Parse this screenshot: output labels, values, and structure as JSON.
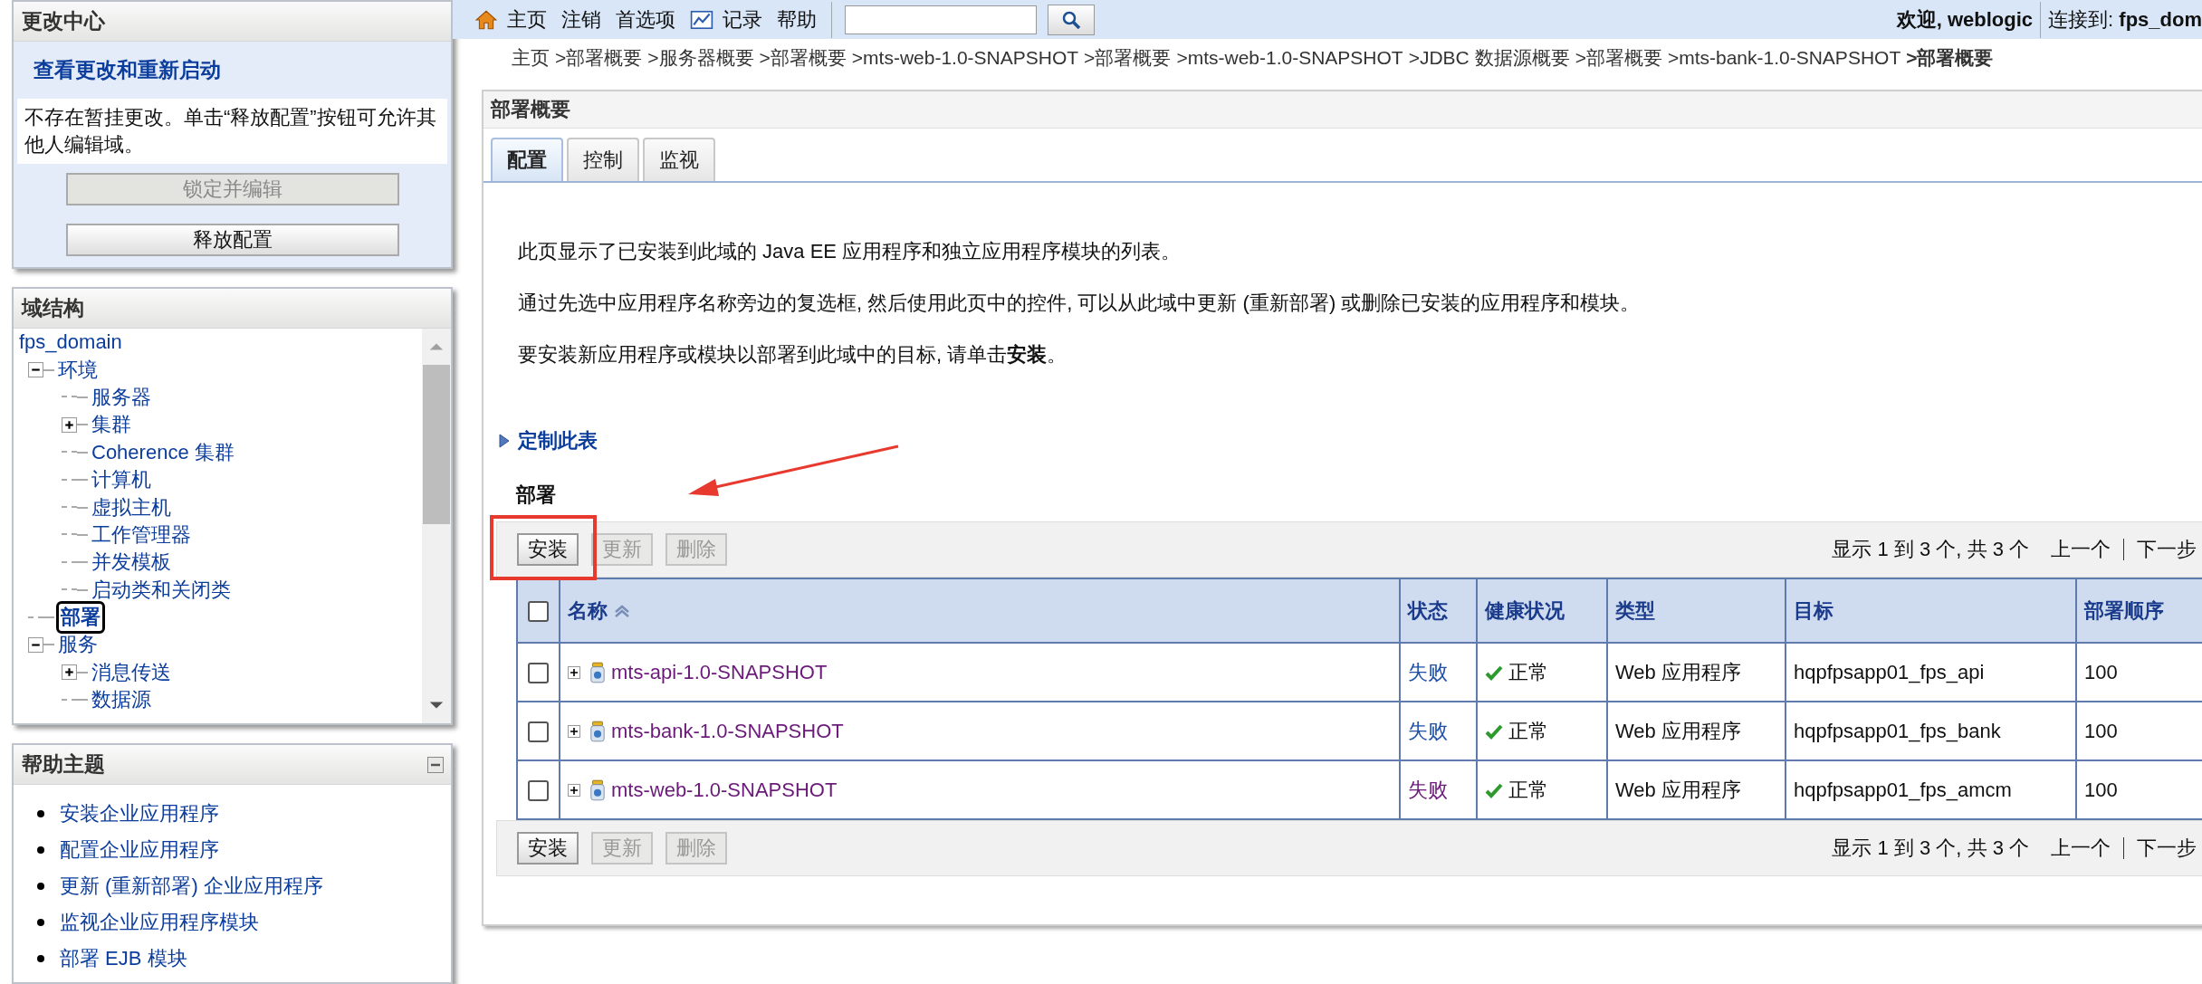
{
  "change_center": {
    "title": "更改中心",
    "link": "查看更改和重新启动",
    "message": "不存在暂挂更改。单击“释放配置”按钮可允许其他人编辑域。",
    "buttons": [
      {
        "label": "锁定并编辑",
        "disabled": true
      },
      {
        "label": "释放配置",
        "disabled": false
      }
    ]
  },
  "domain_structure": {
    "title": "域结构",
    "tree": {
      "label": "fps_domain",
      "selected": false,
      "children": [
        {
          "label": "环境",
          "selected": false,
          "expanded": true,
          "children": [
            {
              "label": "服务器",
              "selected": false
            },
            {
              "label": "集群",
              "selected": false,
              "expanded": false
            },
            {
              "label": "Coherence 集群",
              "selected": false
            },
            {
              "label": "计算机",
              "selected": false
            },
            {
              "label": "虚拟主机",
              "selected": false
            },
            {
              "label": "工作管理器",
              "selected": false
            },
            {
              "label": "并发模板",
              "selected": false
            },
            {
              "label": "启动类和关闭类",
              "selected": false
            }
          ]
        },
        {
          "label": "部署",
          "selected": true
        },
        {
          "label": "服务",
          "selected": false,
          "expanded": true,
          "children": [
            {
              "label": "消息传送",
              "selected": false,
              "expanded": false
            },
            {
              "label": "数据源",
              "selected": false
            }
          ]
        }
      ]
    }
  },
  "help_topics": {
    "title": "帮助主题",
    "items": [
      "安装企业应用程序",
      "配置企业应用程序",
      "更新 (重新部署) 企业应用程序",
      "监视企业应用程序模块",
      "部署 EJB 模块"
    ]
  },
  "top_bar": {
    "links": [
      {
        "label": "主页",
        "kind": "home"
      },
      {
        "label": "注销",
        "kind": "plain"
      },
      {
        "label": "首选项",
        "kind": "plain"
      },
      {
        "label": "记录",
        "kind": "record"
      },
      {
        "label": "帮助",
        "kind": "plain"
      }
    ],
    "welcome": "欢迎, weblogic",
    "connection": "连接到: **fps_dom**"
  },
  "breadcrumbs": [
    "主页",
    ">部署概要",
    ">服务器概要",
    ">部署概要",
    ">mts-web-1.0-SNAPSHOT",
    ">部署概要",
    ">mts-web-1.0-SNAPSHOT",
    ">JDBC 数据源概要",
    ">部署概要",
    ">mts-bank-1.0-SNAPSHOT",
    ">部署概要"
  ],
  "panel": {
    "title": "部署概要",
    "tabs": [
      {
        "label": "配置",
        "selected": true
      },
      {
        "label": "控制",
        "selected": false
      },
      {
        "label": "监视",
        "selected": false
      }
    ],
    "paragraphs": [
      "此页显示了已安装到此域的 Java EE 应用程序和独立应用程序模块的列表。",
      "通过先选中应用程序名称旁边的复选框, 然后使用此页中的控件, 可以从此域中更新 (重新部署) 或删除已安装的应用程序和模块。",
      "要安装新应用程序或模块以部署到此域中的目标, 请单击**安装**。"
    ],
    "customize": "定制此表",
    "table_title": "部署",
    "top_toolbar": {
      "buttons": [
        {
          "label": "安装",
          "disabled": false
        },
        {
          "label": "更新",
          "disabled": true
        },
        {
          "label": "删除",
          "disabled": true
        }
      ],
      "pager": "显示 1 到 3 个, 共 3 个",
      "prev": "上一个",
      "next": "下一步"
    },
    "table": {
      "select_all_checked": false,
      "columns": [
        "名称",
        "状态",
        "健康状况",
        "类型",
        "目标",
        "部署顺序"
      ],
      "rows": [
        {
          "checked": false,
          "name": "mts-api-1.0-SNAPSHOT",
          "status": "失败",
          "status_visited": false,
          "health": "正常",
          "type": "Web 应用程序",
          "target": "hqpfpsapp01_fps_api",
          "order": "100"
        },
        {
          "checked": false,
          "name": "mts-bank-1.0-SNAPSHOT",
          "status": "失败",
          "status_visited": false,
          "health": "正常",
          "type": "Web 应用程序",
          "target": "hqpfpsapp01_fps_bank",
          "order": "100"
        },
        {
          "checked": false,
          "name": "mts-web-1.0-SNAPSHOT",
          "status": "失败",
          "status_visited": true,
          "health": "正常",
          "type": "Web 应用程序",
          "target": "hqpfpsapp01_fps_amcm",
          "order": "100"
        }
      ]
    },
    "bottom_toolbar": {
      "buttons": [
        {
          "label": "安装",
          "disabled": false
        },
        {
          "label": "更新",
          "disabled": true
        },
        {
          "label": "删除",
          "disabled": true
        }
      ],
      "pager": "显示 1 到 3 个, 共 3 个",
      "prev": "上一个",
      "next": "下一步"
    }
  }
}
